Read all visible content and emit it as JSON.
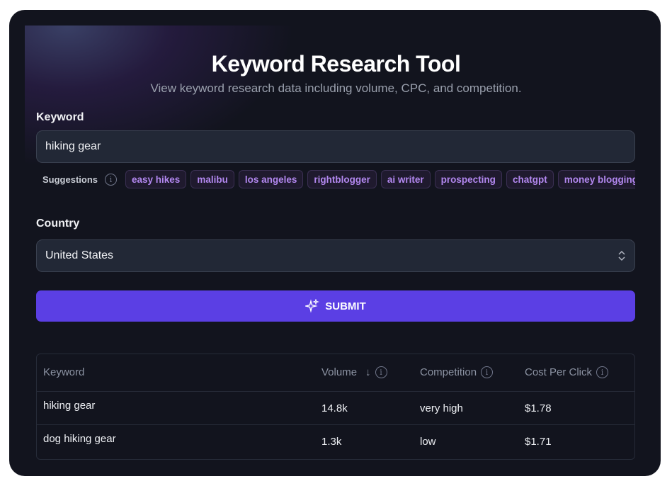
{
  "header": {
    "title": "Keyword Research Tool",
    "subtitle": "View keyword research data including volume, CPC, and competition."
  },
  "keyword": {
    "label": "Keyword",
    "value": "hiking gear"
  },
  "suggestions": {
    "label": "Suggestions",
    "items": [
      "easy hikes",
      "malibu",
      "los angeles",
      "rightblogger",
      "ai writer",
      "prospecting",
      "chatgpt",
      "money blogging",
      ""
    ]
  },
  "country": {
    "label": "Country",
    "value": "United States"
  },
  "submit": {
    "label": "SUBMIT"
  },
  "table": {
    "columns": [
      "Keyword",
      "Volume",
      "Competition",
      "Cost Per Click"
    ],
    "rows": [
      {
        "keyword": "hiking gear",
        "volume": "14.8k",
        "competition": "very high",
        "cpc": "$1.78"
      },
      {
        "keyword": "dog hiking gear",
        "volume": "1.3k",
        "competition": "low",
        "cpc": "$1.71"
      }
    ]
  },
  "colors": {
    "accent": "#5b3fe4",
    "chip_text": "#b388f0",
    "background": "#12141e"
  }
}
